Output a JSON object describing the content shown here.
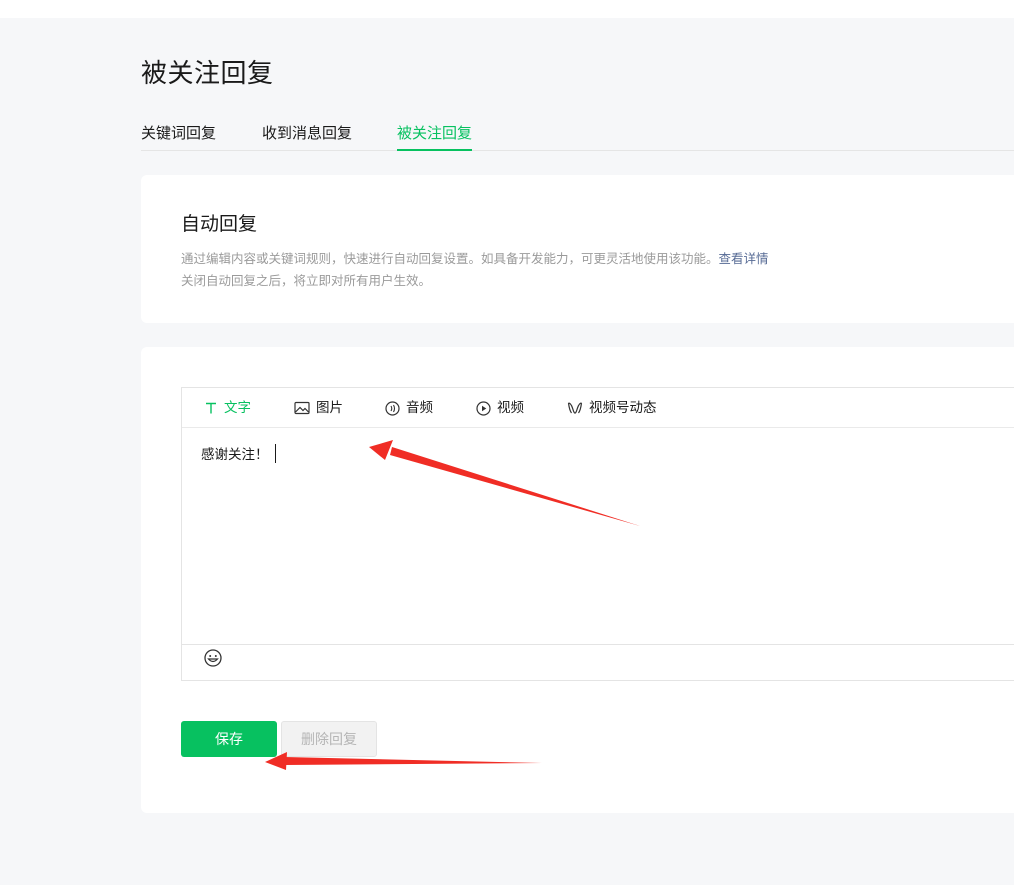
{
  "page": {
    "title": "被关注回复"
  },
  "tabs": [
    {
      "label": "关键词回复",
      "active": false
    },
    {
      "label": "收到消息回复",
      "active": false
    },
    {
      "label": "被关注回复",
      "active": true
    }
  ],
  "auto_reply": {
    "title": "自动回复",
    "desc_line1": "通过编辑内容或关键词规则，快速进行自动回复设置。如具备开发能力，可更灵活地使用该功能。",
    "desc_link": "查看详情",
    "desc_line2": "关闭自动回复之后，将立即对所有用户生效。"
  },
  "editor": {
    "tools": [
      {
        "label": "文字",
        "icon": "text-icon",
        "active": true
      },
      {
        "label": "图片",
        "icon": "image-icon",
        "active": false
      },
      {
        "label": "音频",
        "icon": "audio-icon",
        "active": false
      },
      {
        "label": "视频",
        "icon": "video-icon",
        "active": false
      },
      {
        "label": "视频号动态",
        "icon": "channels-icon",
        "active": false
      }
    ],
    "content": "感谢关注！",
    "emoji_icon": "emoji-icon"
  },
  "actions": {
    "save_label": "保存",
    "delete_label": "删除回复"
  },
  "colors": {
    "accent": "#07c160",
    "link": "#576b95",
    "annotation_arrow": "#f02d25"
  }
}
